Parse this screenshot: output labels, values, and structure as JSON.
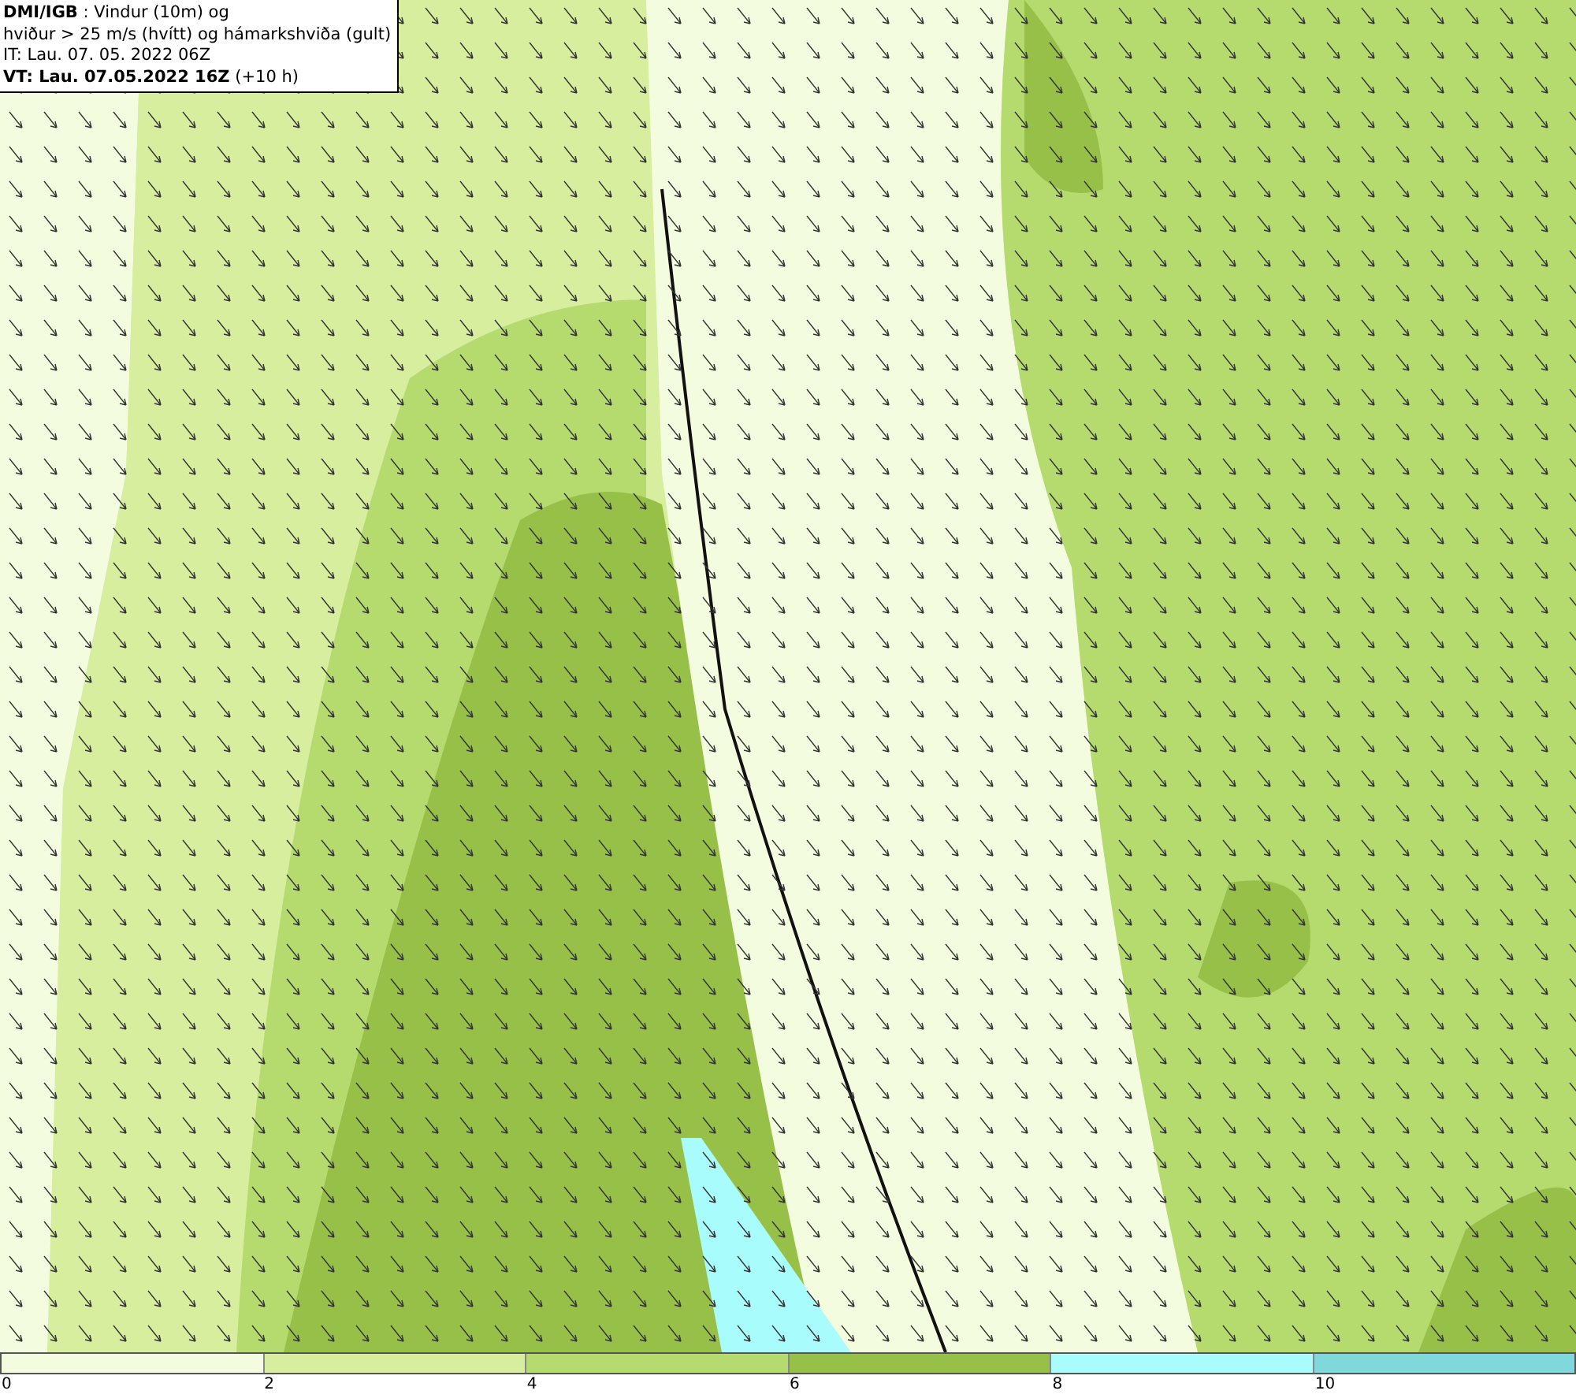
{
  "legend": {
    "lines": [
      "**DMI/IGB** : Vindur (10m) og",
      "hviður > 25 m/s (hvítt) og hámarkshviða (gult)",
      "IT: Lau. 07. 05. 2022 06Z",
      "**VT: Lau. 07.05.2022 16Z** (+10 h)"
    ]
  },
  "color_scale": {
    "segments": [
      {
        "color": "#f4fce0"
      },
      {
        "color": "#d6ee9e"
      },
      {
        "color": "#b5db6e"
      },
      {
        "color": "#97c048"
      },
      {
        "color": "#a8fcfc"
      },
      {
        "color": "#7fd8da"
      }
    ],
    "ticks": [
      "0",
      "2",
      "4",
      "6",
      "8",
      "10"
    ]
  }
}
